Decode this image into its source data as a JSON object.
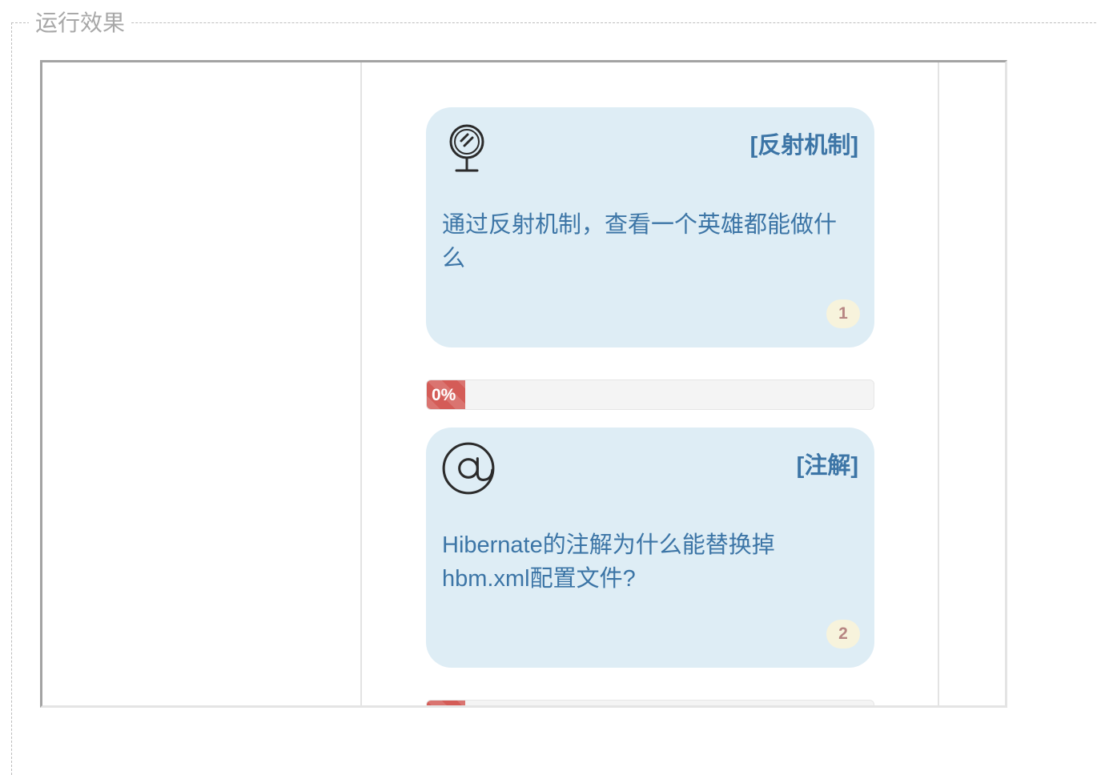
{
  "legend": "运行效果",
  "cards": [
    {
      "icon": "mirror-icon",
      "category": "[反射机制]",
      "description": "通过反射机制，查看一个英雄都能做什么",
      "badge": "1"
    },
    {
      "icon": "at-sign-icon",
      "category": "[注解]",
      "description": "Hibernate的注解为什么能替换掉hbm.xml配置文件?",
      "badge": "2"
    }
  ],
  "progress": [
    {
      "label": "0%",
      "value": 0
    }
  ],
  "colors": {
    "card_bg": "#deedf5",
    "text": "#3c75a6",
    "progress_fill": "#d45c57",
    "badge_bg": "#f7f3dc"
  }
}
